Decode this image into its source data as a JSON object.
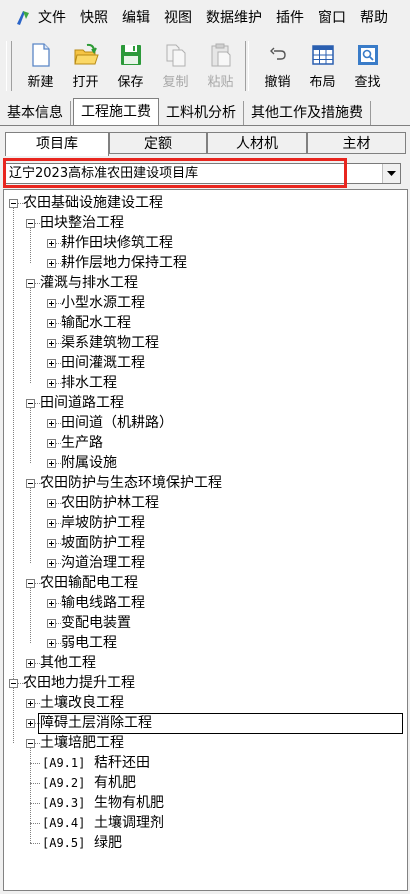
{
  "menu": {
    "items": [
      "文件",
      "快照",
      "编辑",
      "视图",
      "数据维护",
      "插件",
      "窗口",
      "帮助"
    ]
  },
  "toolbar": {
    "buttons": [
      {
        "label": "新建",
        "icon": "new-file-icon",
        "enabled": true
      },
      {
        "label": "打开",
        "icon": "open-folder-icon",
        "enabled": true
      },
      {
        "label": "保存",
        "icon": "save-disk-icon",
        "enabled": true
      },
      {
        "label": "复制",
        "icon": "copy-icon",
        "enabled": false
      },
      {
        "label": "粘贴",
        "icon": "paste-icon",
        "enabled": false
      },
      {
        "label": "撤销",
        "icon": "undo-icon",
        "enabled": true
      },
      {
        "label": "布局",
        "icon": "layout-grid-icon",
        "enabled": true
      },
      {
        "label": "查找",
        "icon": "find-icon",
        "enabled": true
      }
    ]
  },
  "tabs": [
    "基本信息",
    "工程施工费",
    "工料机分析",
    "其他工作及措施费"
  ],
  "active_tab": "工程施工费",
  "subtabs": [
    "项目库",
    "定额",
    "人材机",
    "主材"
  ],
  "active_subtab": "项目库",
  "library_select": {
    "value": "辽宁2023高标准农田建设项目库",
    "accent_color": "#e8261f"
  },
  "tree": [
    {
      "label": "农田基础设施建设工程",
      "level": 0,
      "state": "expanded"
    },
    {
      "label": "田块整治工程",
      "level": 1,
      "state": "expanded"
    },
    {
      "label": "耕作田块修筑工程",
      "level": 2,
      "state": "collapsed"
    },
    {
      "label": "耕作层地力保持工程",
      "level": 2,
      "state": "collapsed"
    },
    {
      "label": "灌溉与排水工程",
      "level": 1,
      "state": "expanded"
    },
    {
      "label": "小型水源工程",
      "level": 2,
      "state": "collapsed"
    },
    {
      "label": "输配水工程",
      "level": 2,
      "state": "collapsed"
    },
    {
      "label": "渠系建筑物工程",
      "level": 2,
      "state": "collapsed"
    },
    {
      "label": "田间灌溉工程",
      "level": 2,
      "state": "collapsed"
    },
    {
      "label": "排水工程",
      "level": 2,
      "state": "collapsed"
    },
    {
      "label": "田间道路工程",
      "level": 1,
      "state": "expanded"
    },
    {
      "label": "田间道（机耕路）",
      "level": 2,
      "state": "collapsed"
    },
    {
      "label": "生产路",
      "level": 2,
      "state": "collapsed"
    },
    {
      "label": "附属设施",
      "level": 2,
      "state": "collapsed"
    },
    {
      "label": "农田防护与生态环境保护工程",
      "level": 1,
      "state": "expanded"
    },
    {
      "label": "农田防护林工程",
      "level": 2,
      "state": "collapsed"
    },
    {
      "label": "岸坡防护工程",
      "level": 2,
      "state": "collapsed"
    },
    {
      "label": "坡面防护工程",
      "level": 2,
      "state": "collapsed"
    },
    {
      "label": "沟道治理工程",
      "level": 2,
      "state": "collapsed"
    },
    {
      "label": "农田输配电工程",
      "level": 1,
      "state": "expanded"
    },
    {
      "label": "输电线路工程",
      "level": 2,
      "state": "collapsed"
    },
    {
      "label": "变配电装置",
      "level": 2,
      "state": "collapsed"
    },
    {
      "label": "弱电工程",
      "level": 2,
      "state": "collapsed"
    },
    {
      "label": "其他工程",
      "level": 1,
      "state": "collapsed"
    },
    {
      "label": "农田地力提升工程",
      "level": 0,
      "state": "expanded"
    },
    {
      "label": "土壤改良工程",
      "level": 1,
      "state": "collapsed"
    },
    {
      "label": "障碍土层消除工程",
      "level": 1,
      "state": "collapsed",
      "selected": true
    },
    {
      "label": "土壤培肥工程",
      "level": 1,
      "state": "expanded"
    },
    {
      "code": "[A9.1]",
      "label": "秸秆还田",
      "level": 2,
      "state": "leaf"
    },
    {
      "code": "[A9.2]",
      "label": "有机肥",
      "level": 2,
      "state": "leaf"
    },
    {
      "code": "[A9.3]",
      "label": "生物有机肥",
      "level": 2,
      "state": "leaf"
    },
    {
      "code": "[A9.4]",
      "label": "土壤调理剂",
      "level": 2,
      "state": "leaf"
    },
    {
      "code": "[A9.5]",
      "label": "绿肥",
      "level": 2,
      "state": "leaf"
    }
  ]
}
